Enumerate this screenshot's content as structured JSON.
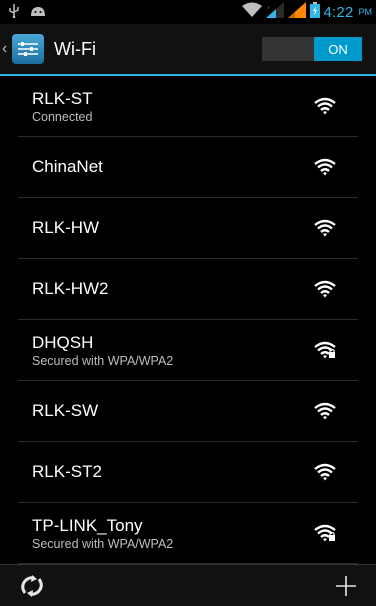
{
  "status_bar": {
    "time": "4:22",
    "ampm": "PM",
    "icons": [
      "usb-icon",
      "android-debug-icon",
      "wifi-signal-icon",
      "cell-signal-icon-1",
      "cell-signal-icon-2",
      "battery-icon"
    ],
    "accent": "#33b5e5"
  },
  "action_bar": {
    "title": "Wi-Fi",
    "toggle_label": "ON",
    "toggle_color": "#0099cc"
  },
  "networks": [
    {
      "ssid": "RLK-ST",
      "summary": "Connected",
      "secured": false
    },
    {
      "ssid": "ChinaNet",
      "summary": "",
      "secured": false
    },
    {
      "ssid": "RLK-HW",
      "summary": "",
      "secured": false
    },
    {
      "ssid": "RLK-HW2",
      "summary": "",
      "secured": false
    },
    {
      "ssid": "DHQSH",
      "summary": "Secured with WPA/WPA2",
      "secured": true
    },
    {
      "ssid": "RLK-SW",
      "summary": "",
      "secured": false
    },
    {
      "ssid": "RLK-ST2",
      "summary": "",
      "secured": false
    },
    {
      "ssid": "TP-LINK_Tony",
      "summary": "Secured with WPA/WPA2",
      "secured": true
    }
  ],
  "bottom_bar": {
    "icons": [
      "scan-icon",
      "add-network-icon"
    ]
  }
}
